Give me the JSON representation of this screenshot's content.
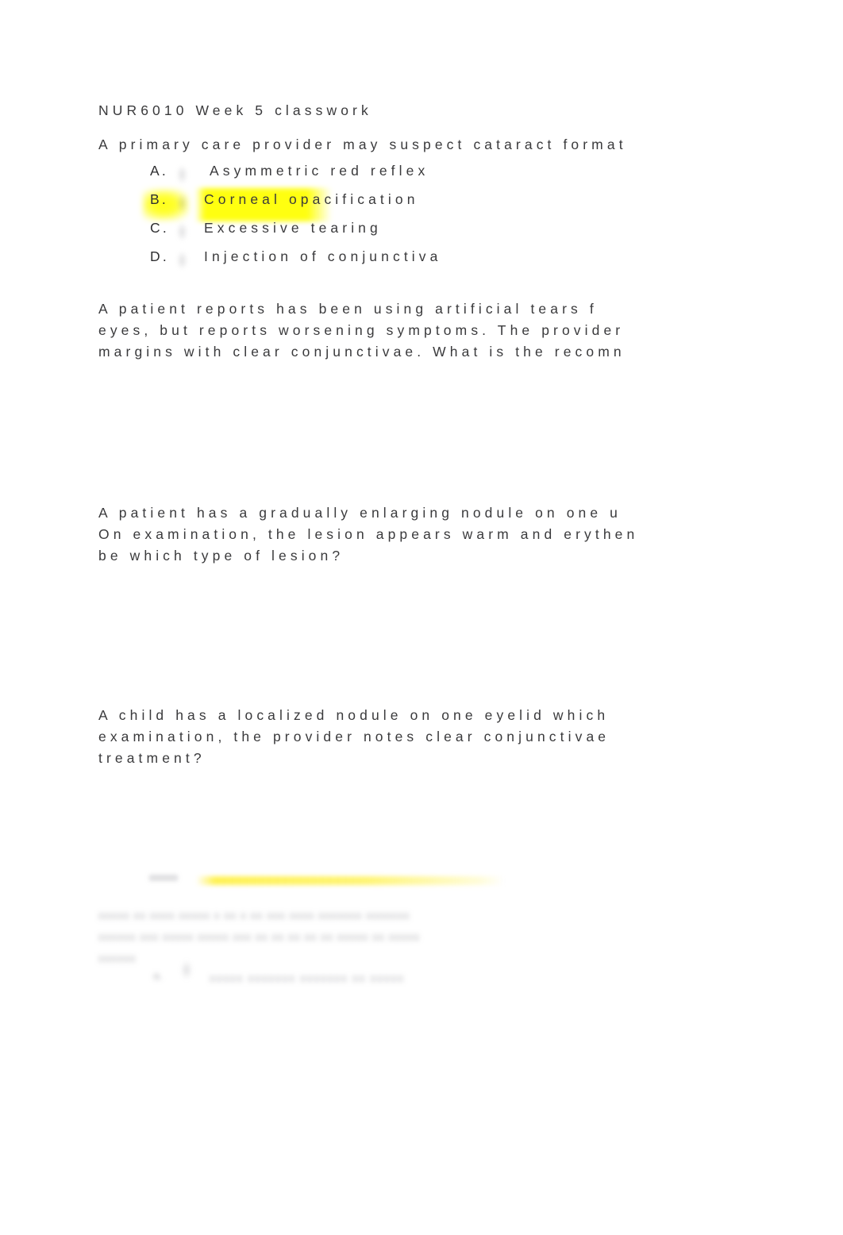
{
  "document": {
    "title": "NUR6010 Week 5 classwork",
    "background_color": "#ffffff",
    "text_color": "#3a3a3c",
    "highlight_color": "#ffff00"
  },
  "questions": [
    {
      "id": "q1",
      "stem_lines": [
        "A primary care provider may suspect cataract format"
      ],
      "options": [
        {
          "marker": "A.",
          "text": "Asymmetric red reflex",
          "highlighted": false
        },
        {
          "marker": "B.",
          "text": "Corneal opacification",
          "highlighted": true
        },
        {
          "marker": "C.",
          "text": "Excessive tearing",
          "highlighted": false
        },
        {
          "marker": "D.",
          "text": "Injection of conjunctiva",
          "highlighted": false
        }
      ]
    },
    {
      "id": "q2",
      "stem_lines": [
        "A patient reports has been using artificial tears f",
        "eyes, but reports worsening symptoms. The provider",
        "margins with clear conjunctivae. What is the recomn"
      ],
      "options": []
    },
    {
      "id": "q3",
      "stem_lines": [
        "A patient has a gradually enlarging nodule on one u",
        "On examination, the lesion appears warm and erythen",
        "be which type of lesion?"
      ],
      "options": []
    },
    {
      "id": "q4",
      "stem_lines": [
        "A child has a localized nodule on one eyelid which",
        "examination, the provider notes clear conjunctivae",
        "treatment?"
      ],
      "options": []
    }
  ],
  "faded_region": {
    "note": "illegible blurred scan content",
    "paragraph_lines": [
      "xxxxx xx xxxx  xxxxx x  xx x xx xxx  xxxx xxxxxxx  xxxxxxx",
      "xxxxxx xxx xxxxx xxxxx  xxx  xx xx xx   xx xx   xxxxx xx xxxxx",
      "xxxxxx"
    ],
    "bullet_marker": "a.",
    "bullet_text": "xxxxx xxxxxxx  xxxxxxx  xx xxxxx"
  }
}
